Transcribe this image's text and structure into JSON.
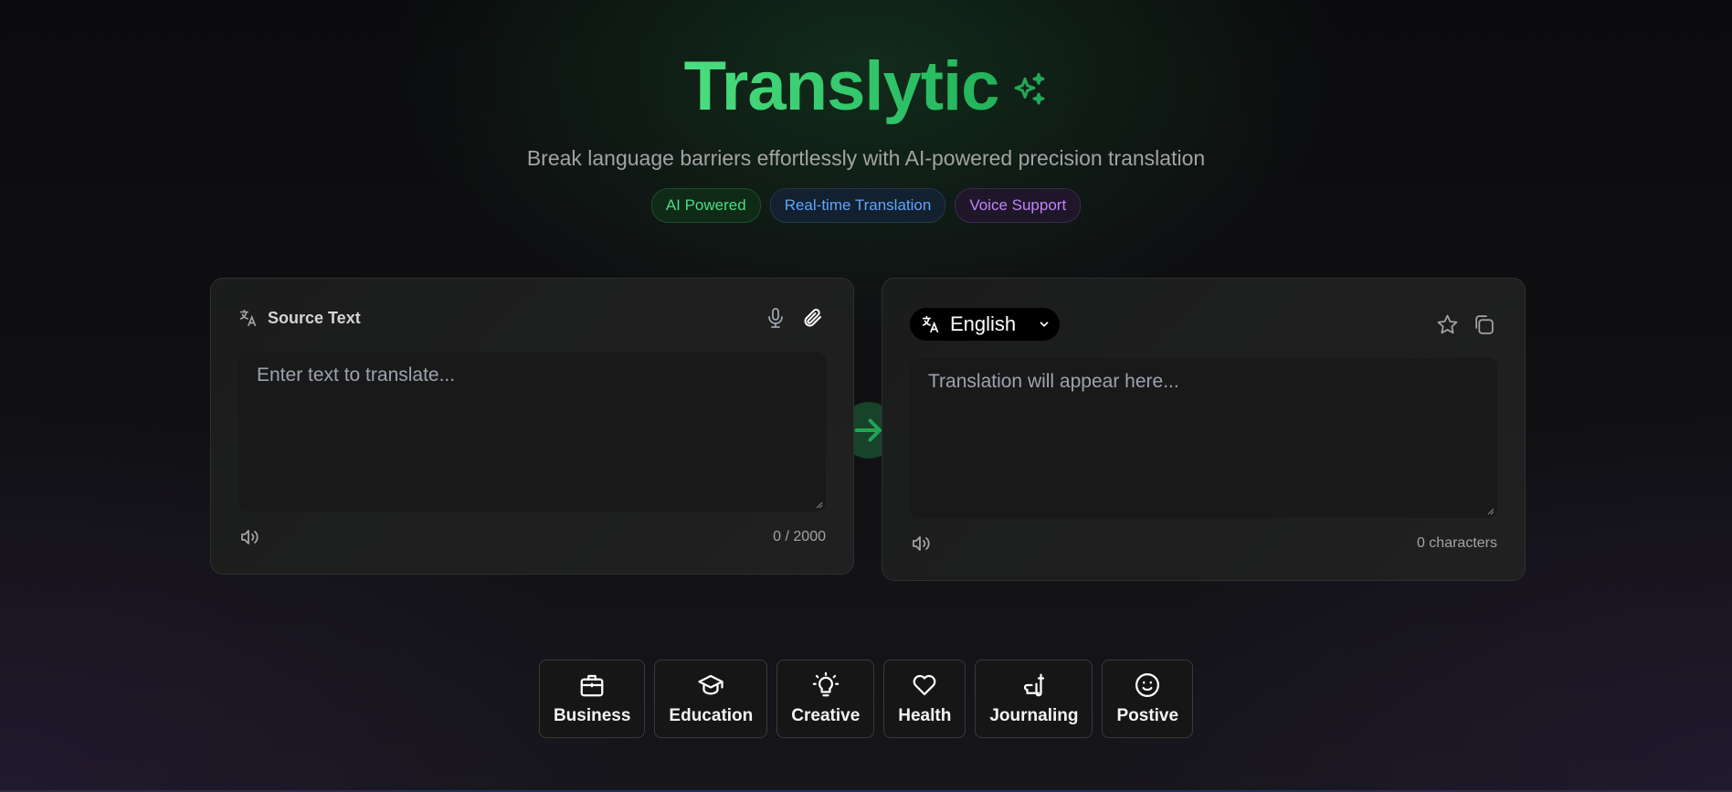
{
  "header": {
    "title": "Translytic",
    "title_icon": "sparkles-icon",
    "subtitle": "Break language barriers effortlessly with AI-powered precision translation",
    "badges": [
      {
        "label": "AI Powered",
        "color": "#4ade80"
      },
      {
        "label": "Real-time Translation",
        "color": "#60a5fa"
      },
      {
        "label": "Voice Support",
        "color": "#c084fc"
      }
    ]
  },
  "source": {
    "label": "Source Text",
    "label_icon": "translate-icon",
    "actions": [
      "microphone-icon",
      "paperclip-icon"
    ],
    "placeholder": "Enter text to translate...",
    "value": "",
    "speaker_icon": "speaker-icon",
    "char_count": "0 / 2000"
  },
  "swap": {
    "icon": "arrow-right-icon",
    "color": "#22c55e"
  },
  "target": {
    "language": "English",
    "language_icon": "translate-icon",
    "actions": [
      "star-icon",
      "copy-icon"
    ],
    "placeholder": "Translation will appear here...",
    "value": "",
    "speaker_icon": "speaker-icon",
    "char_count": "0 characters"
  },
  "categories": [
    {
      "label": "Business",
      "icon": "briefcase-icon"
    },
    {
      "label": "Education",
      "icon": "graduation-cap-icon"
    },
    {
      "label": "Creative",
      "icon": "lightbulb-icon"
    },
    {
      "label": "Health",
      "icon": "heart-icon"
    },
    {
      "label": "Journaling",
      "icon": "pen-icon"
    },
    {
      "label": "Postive",
      "icon": "smile-icon"
    }
  ],
  "colors": {
    "accent": "#22c55e",
    "background": "#0f0f11",
    "card": "#1e1e1e"
  }
}
